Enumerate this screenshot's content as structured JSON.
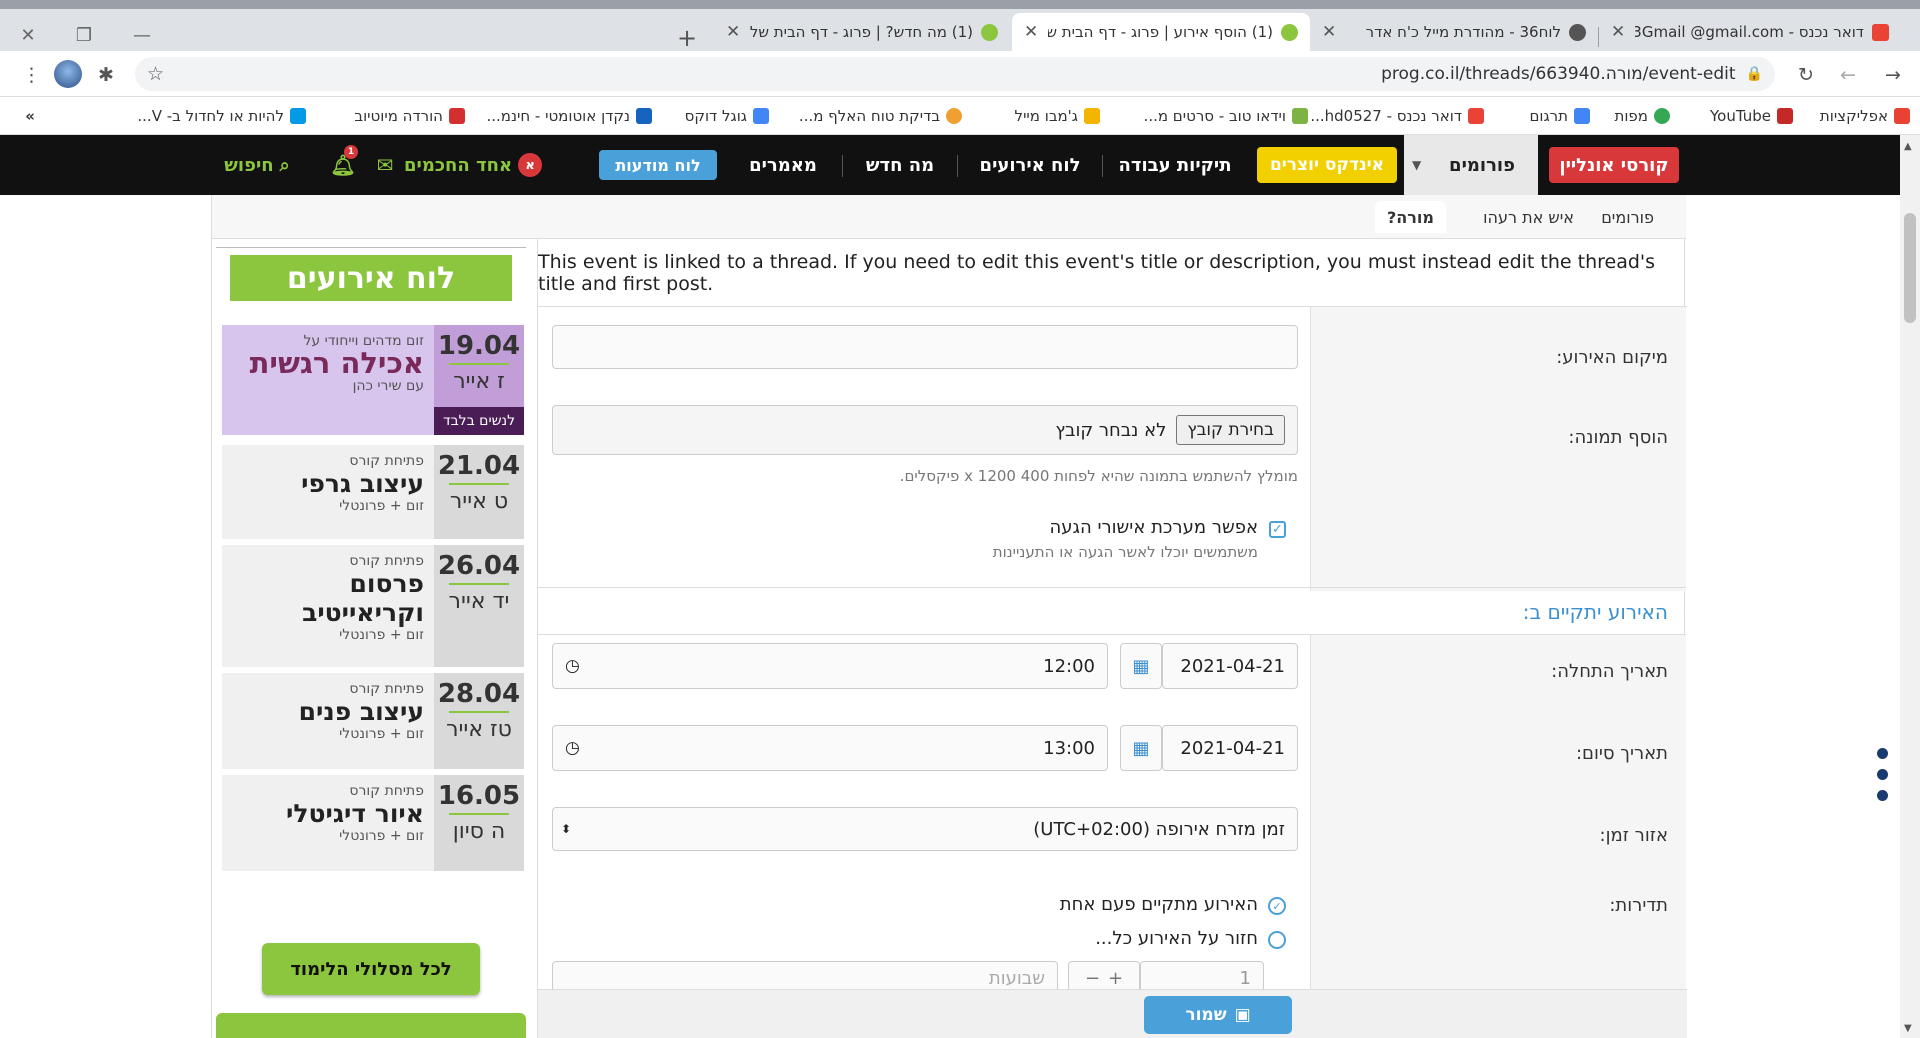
{
  "browser": {
    "tabs": [
      {
        "title": "דואר נכנס - Gmail ⁩@gmail.com⁨3",
        "icon": "gmail-icon"
      },
      {
        "title": "לוח36 - מהודרת מייל כ'ח אדר",
        "icon": "globe-icon"
      },
      {
        "title": "(1) הוסף אירוע | פרוג - דף הבית ש",
        "icon": "prog-icon"
      },
      {
        "title": "(1) מה חדש? | פרוג - דף הבית של",
        "icon": "prog-icon"
      }
    ],
    "url": "prog.co.il/threads/663940.מורה/event-edit",
    "bookmarks": [
      {
        "label": "אפליקציות",
        "icon": "apps-icon",
        "color": "#e94235"
      },
      {
        "label": "YouTube",
        "icon": "youtube-icon",
        "color": "#c62828"
      },
      {
        "label": "מפות",
        "icon": "maps-icon",
        "color": "#34a853"
      },
      {
        "label": "תרגום",
        "icon": "translate-icon",
        "color": "#4285f4"
      },
      {
        "label": "דואר נכנס - hd0527...",
        "icon": "gmail-icon",
        "color": "#ea4335"
      },
      {
        "label": "וידאו טוב - סרטים מ...",
        "icon": "video-icon",
        "color": "#7cb342"
      },
      {
        "label": "ג'מבו מייל",
        "icon": "jumbo-icon",
        "color": "#f4b400"
      },
      {
        "label": "בדיקת טוח האלף מ...",
        "icon": "check-icon",
        "color": "#f0a030"
      },
      {
        "label": "גוגל דוקס",
        "icon": "docs-icon",
        "color": "#4285f4"
      },
      {
        "label": "נקדן אוטומטי - חינמ...",
        "icon": "alef-icon",
        "color": "#1565c0"
      },
      {
        "label": "הורדה מיוטיוב",
        "icon": "ytdl-icon",
        "color": "#d32f2f"
      },
      {
        "label": "להיות או לחדול ב- V...",
        "icon": "bookmark-icon",
        "color": "#039be5"
      }
    ],
    "more_bookmarks": "»"
  },
  "nav": {
    "online_courses": "קורסי אונליין",
    "forums": "פורומים",
    "creators_index": "אינדקס יוצרים",
    "job_folders": "תיקיות עבודה",
    "events_board": "לוח אירועים",
    "whats_new": "מה חדש",
    "articles": "מאמרים",
    "ads_board": "לוח מודעות",
    "user_name": "אחד החכמים",
    "user_initial": "א",
    "notif_count": "1",
    "search": "חיפוש",
    "colors": {
      "red": "#d9383a",
      "yellow": "#f2d000",
      "blue": "#4aa0d8",
      "green": "#8cc63f"
    }
  },
  "breadcrumbs": [
    "פורומים",
    "איש את רעהו",
    "מורה?"
  ],
  "sidebar": {
    "title": "לוח אירועים",
    "events": [
      {
        "day": "19.04",
        "hebrew": "ז אייר",
        "pre": "זום מדהים וייחודי על",
        "name": "אכילה רגשית",
        "sub": "עם שירי כהן",
        "badge": "לנשים בלבד"
      },
      {
        "day": "21.04",
        "hebrew": "ט אייר",
        "pre": "פתיחת קורס",
        "name": "עיצוב גרפי",
        "sub": "זום + פרונטלי"
      },
      {
        "day": "26.04",
        "hebrew": "יד אייר",
        "pre": "פתיחת קורס",
        "name": "פרסום וקריאייטיב",
        "sub": "זום + פרונטלי"
      },
      {
        "day": "28.04",
        "hebrew": "טז אייר",
        "pre": "פתיחת קורס",
        "name": "עיצוב פנים",
        "sub": "זום + פרונטלי"
      },
      {
        "day": "16.05",
        "hebrew": "ה סיון",
        "pre": "פתיחת קורס",
        "name": "איור דיגיטלי",
        "sub": "זום + פרונטלי"
      }
    ],
    "all_tracks_button": "לכל מסלולי הלימוד"
  },
  "form": {
    "notice": "This event is linked to a thread. If you need to edit this event's title or description, you must instead edit the thread's title and first post.",
    "location_label": "מיקום האירוע:",
    "location_value": "",
    "image_label": "הוסף תמונה:",
    "choose_file": "בחירת קובץ",
    "no_file": "לא נבחר קובץ",
    "image_hint": "מומלץ להשתמש בתמונה שהיא לפחות 400 x 1200 פיקסלים.",
    "rsvp_label": "אפשר מערכת אישורי הגעה",
    "rsvp_hint": "משתמשים יוכלו לאשר הגעה או התעניינות",
    "section_title": "האירוע יתקיים ב:",
    "start_label": "תאריך התחלה:",
    "start_date": "2021-04-21",
    "start_time": "12:00",
    "end_label": "תאריך סיום:",
    "end_date": "2021-04-21",
    "end_time": "13:00",
    "tz_label": "אזור זמן:",
    "tz_value": "זמן מזרח אירופה (UTC+02:00)",
    "freq_label": "תדירות:",
    "freq_once": "האירוע מתקיים פעם אחת",
    "freq_repeat": "חזור על האירוע כל...",
    "repeat_count": "1",
    "repeat_unit": "שבועות",
    "save": "שמור"
  }
}
